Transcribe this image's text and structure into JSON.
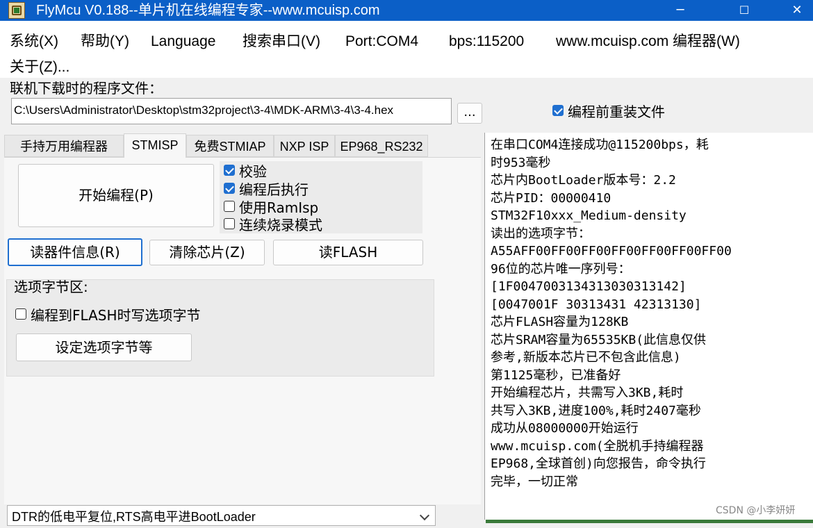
{
  "window": {
    "title": "FlyMcu V0.188--单片机在线编程专家--www.mcuisp.com",
    "minimize": "─",
    "maximize": "☐",
    "close": "✕"
  },
  "menu": {
    "items": [
      "系统(X)",
      "帮助(Y)",
      "Language",
      "搜索串口(V)",
      "Port:COM4",
      "bps:115200",
      "www.mcuisp.com 编程器(W)",
      "关于(Z)..."
    ]
  },
  "file": {
    "label": "联机下载时的程序文件：",
    "path": "C:\\Users\\Administrator\\Desktop\\stm32project\\3-4\\MDK-ARM\\3-4\\3-4.hex",
    "browse_label": "...",
    "reload_label": "编程前重装文件",
    "reload_checked": true
  },
  "tabs": [
    "手持万用编程器",
    "STMISP",
    "免费STMIAP",
    "NXP ISP",
    "EP968_RS232"
  ],
  "active_tab": "STMISP",
  "stmisp": {
    "start_button": "开始编程(P)",
    "options": [
      {
        "label": "校验",
        "checked": true
      },
      {
        "label": "编程后执行",
        "checked": true
      },
      {
        "label": "使用RamIsp",
        "checked": false
      },
      {
        "label": "连续烧录模式",
        "checked": false
      }
    ],
    "read_info_button": "读器件信息(R)",
    "erase_button": "清除芯片(Z)",
    "read_flash_button": "读FLASH",
    "option_group_label": "选项字节区:",
    "write_option_label": "编程到FLASH时写选项字节",
    "write_option_checked": false,
    "set_option_button": "设定选项字节等"
  },
  "reset_mode": {
    "selected": "DTR的低电平复位,RTS高电平进BootLoader"
  },
  "log": {
    "lines": [
      "在串口COM4连接成功@115200bps，耗",
      "时953毫秒",
      "芯片内BootLoader版本号：2.2",
      "芯片PID：00000410",
      "STM32F10xxx_Medium-density",
      "读出的选项字节：",
      "A55AFF00FF00FF00FF00FF00FF00FF00",
      "96位的芯片唯一序列号：",
      "[1F0047003134313030313142]",
      "[0047001F 30313431 42313130]",
      "芯片FLASH容量为128KB",
      "芯片SRAM容量为65535KB(此信息仅供",
      "参考,新版本芯片已不包含此信息)",
      "第1125毫秒，已准备好",
      "开始编程芯片，共需写入3KB,耗时",
      "共写入3KB,进度100%,耗时2407毫秒",
      "成功从08000000开始运行",
      "www.mcuisp.com(全脱机手持编程器",
      "EP968,全球首创)向您报告，命令执行",
      "完毕，一切正常"
    ]
  },
  "watermark": "CSDN @小李妍妍"
}
